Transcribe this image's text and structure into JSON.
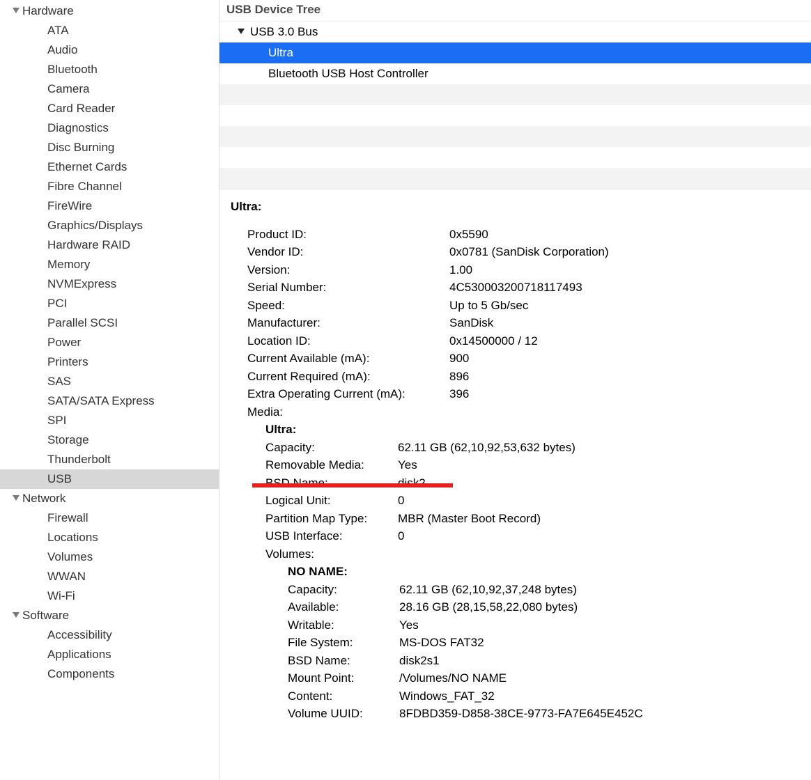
{
  "sidebar": {
    "sections": [
      {
        "label": "Hardware",
        "items": [
          "ATA",
          "Audio",
          "Bluetooth",
          "Camera",
          "Card Reader",
          "Diagnostics",
          "Disc Burning",
          "Ethernet Cards",
          "Fibre Channel",
          "FireWire",
          "Graphics/Displays",
          "Hardware RAID",
          "Memory",
          "NVMExpress",
          "PCI",
          "Parallel SCSI",
          "Power",
          "Printers",
          "SAS",
          "SATA/SATA Express",
          "SPI",
          "Storage",
          "Thunderbolt",
          "USB"
        ]
      },
      {
        "label": "Network",
        "items": [
          "Firewall",
          "Locations",
          "Volumes",
          "WWAN",
          "Wi-Fi"
        ]
      },
      {
        "label": "Software",
        "items": [
          "Accessibility",
          "Applications",
          "Components"
        ]
      }
    ],
    "selected": "USB"
  },
  "main": {
    "header": "USB Device Tree",
    "tree": {
      "bus": "USB 3.0 Bus",
      "children": [
        "Ultra",
        "Bluetooth USB Host Controller"
      ],
      "selected": "Ultra"
    },
    "details": {
      "title": "Ultra:",
      "rows": [
        {
          "k": "Product ID:",
          "v": "0x5590"
        },
        {
          "k": "Vendor ID:",
          "v": "0x0781  (SanDisk Corporation)"
        },
        {
          "k": "Version:",
          "v": "1.00"
        },
        {
          "k": "Serial Number:",
          "v": "4C530003200718117493"
        },
        {
          "k": "Speed:",
          "v": "Up to 5 Gb/sec"
        },
        {
          "k": "Manufacturer:",
          "v": "SanDisk"
        },
        {
          "k": "Location ID:",
          "v": "0x14500000 / 12"
        },
        {
          "k": "Current Available (mA):",
          "v": "900"
        },
        {
          "k": "Current Required (mA):",
          "v": "896"
        },
        {
          "k": "Extra Operating Current (mA):",
          "v": "396"
        }
      ],
      "media_label": "Media:",
      "media_name": "Ultra:",
      "media_rows": [
        {
          "k": "Capacity:",
          "v": "62.11 GB (62,10,92,53,632 bytes)"
        },
        {
          "k": "Removable Media:",
          "v": "Yes"
        },
        {
          "k": "BSD Name:",
          "v": "disk2"
        },
        {
          "k": "Logical Unit:",
          "v": "0"
        },
        {
          "k": "Partition Map Type:",
          "v": "MBR (Master Boot Record)"
        },
        {
          "k": "USB Interface:",
          "v": "0"
        }
      ],
      "volumes_label": "Volumes:",
      "volume_name": "NO NAME:",
      "volume_rows": [
        {
          "k": "Capacity:",
          "v": "62.11 GB (62,10,92,37,248 bytes)"
        },
        {
          "k": "Available:",
          "v": "28.16 GB (28,15,58,22,080 bytes)"
        },
        {
          "k": "Writable:",
          "v": "Yes"
        },
        {
          "k": "File System:",
          "v": "MS-DOS FAT32"
        },
        {
          "k": "BSD Name:",
          "v": "disk2s1"
        },
        {
          "k": "Mount Point:",
          "v": "/Volumes/NO NAME"
        },
        {
          "k": "Content:",
          "v": "Windows_FAT_32"
        },
        {
          "k": "Volume UUID:",
          "v": "8FDBD359-D858-38CE-9773-FA7E645E452C"
        }
      ]
    }
  }
}
